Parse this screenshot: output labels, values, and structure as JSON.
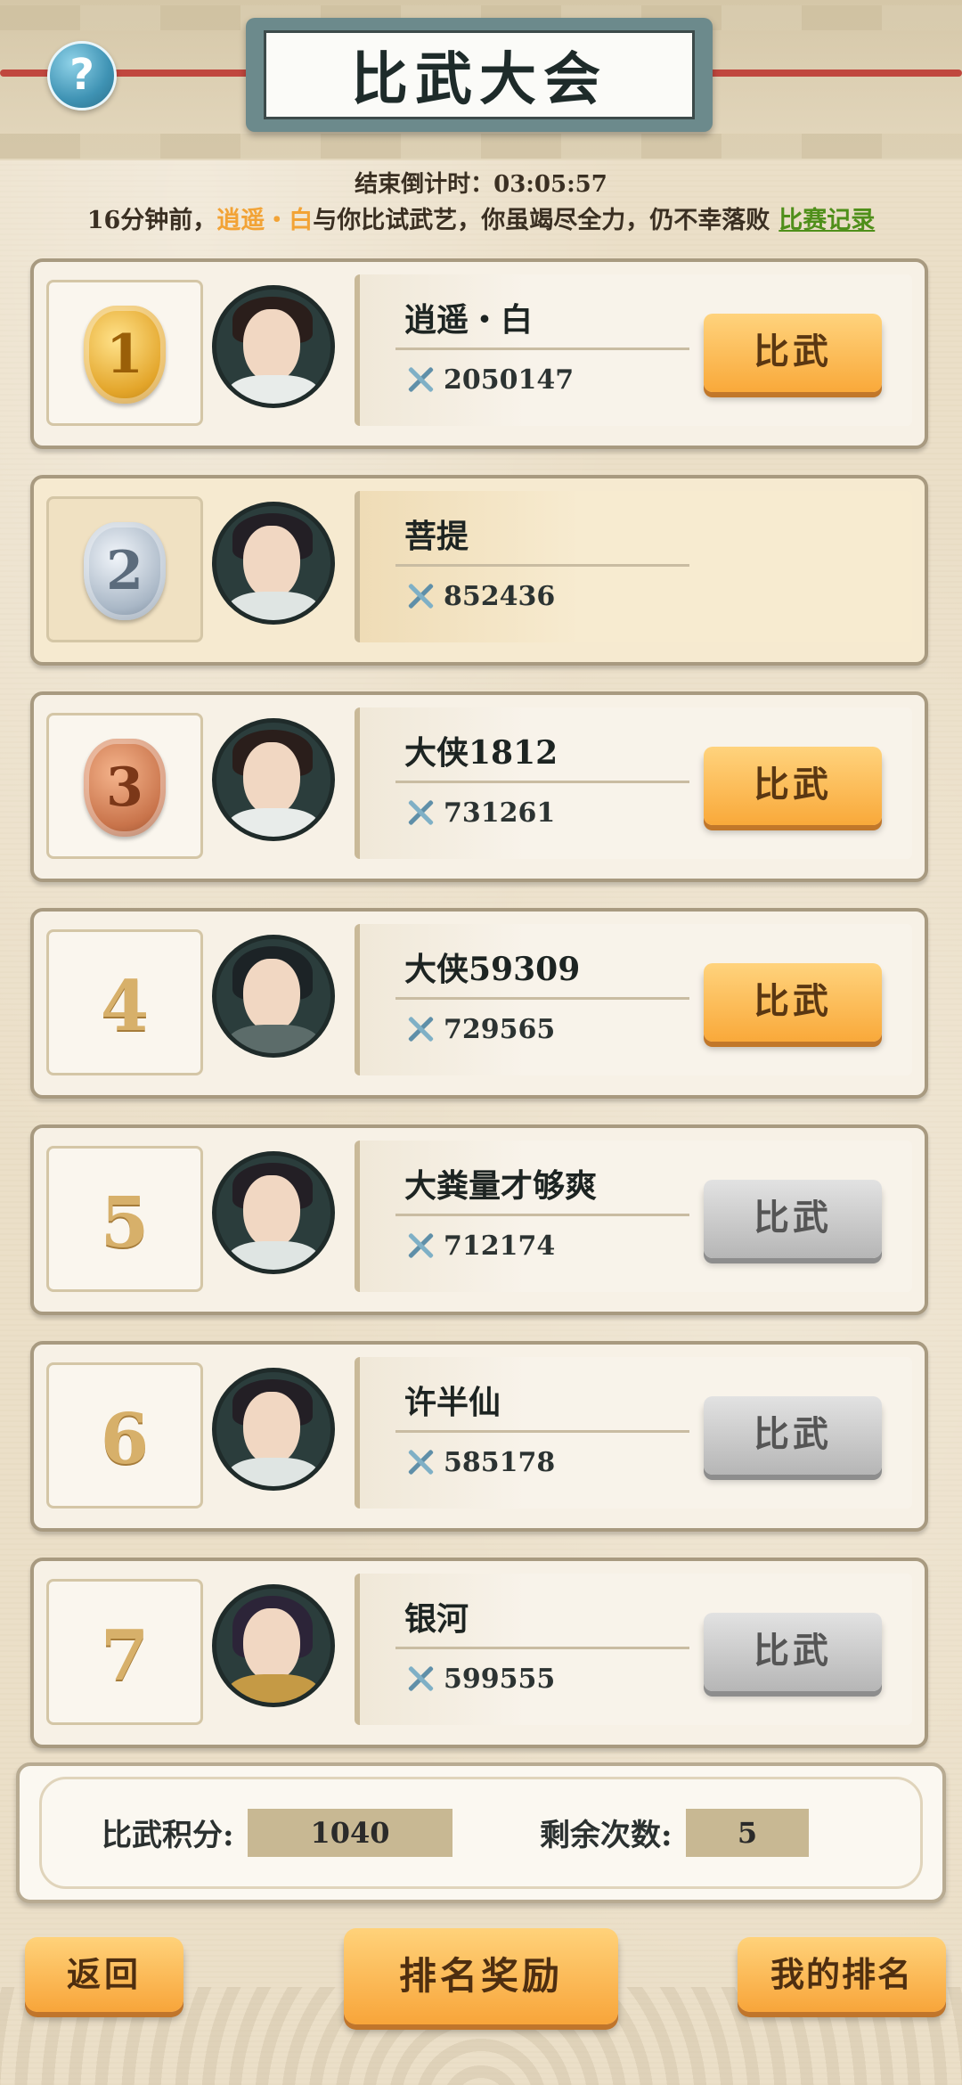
{
  "header": {
    "title": "比武大会",
    "help_label": "?",
    "countdown_label": "结束倒计时：",
    "countdown_value": "03:05:57"
  },
  "notice": {
    "prefix": "16分钟前，",
    "opponent": "逍遥・白",
    "suffix": "与你比试武艺，你虽竭尽全力，仍不幸落败",
    "record_link": "比赛记录"
  },
  "rankings": [
    {
      "rank": "1",
      "medal": "gold",
      "name": "逍遥・白",
      "power": "2050147",
      "button": "比武",
      "button_state": "active"
    },
    {
      "rank": "2",
      "medal": "silver",
      "name": "菩提",
      "power": "852436",
      "button": "",
      "button_state": "none"
    },
    {
      "rank": "3",
      "medal": "bronze",
      "name": "大侠1812",
      "power": "731261",
      "button": "比武",
      "button_state": "active"
    },
    {
      "rank": "4",
      "medal": "",
      "name": "大侠59309",
      "power": "729565",
      "button": "比武",
      "button_state": "active"
    },
    {
      "rank": "5",
      "medal": "",
      "name": "大粪量才够爽",
      "power": "712174",
      "button": "比武",
      "button_state": "disabled"
    },
    {
      "rank": "6",
      "medal": "",
      "name": "许半仙",
      "power": "585178",
      "button": "比武",
      "button_state": "disabled"
    },
    {
      "rank": "7",
      "medal": "",
      "name": "银河",
      "power": "599555",
      "button": "比武",
      "button_state": "disabled"
    }
  ],
  "score": {
    "points_label": "比武积分:",
    "points_value": "1040",
    "remaining_label": "剩余次数:",
    "remaining_value": "5"
  },
  "footer": {
    "back": "返回",
    "rewards": "排名奖励",
    "my_rank": "我的排名"
  }
}
